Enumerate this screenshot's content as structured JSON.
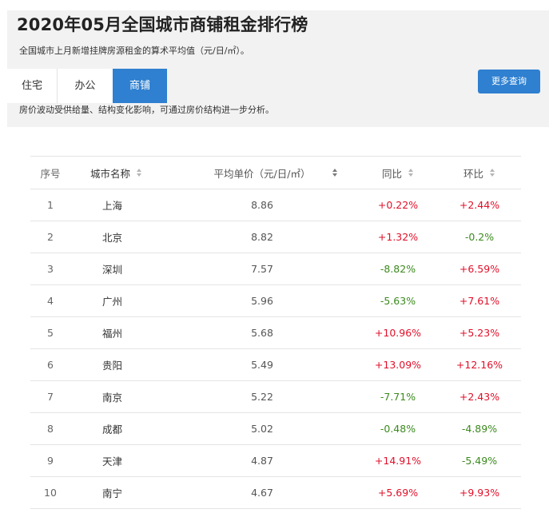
{
  "header": {
    "title": "2020年05月全国城市商铺租金排行榜",
    "subtitle": "全国城市上月新增挂牌房源租金的算术平均值（元/日/㎡）。",
    "note": "房价波动受供给量、结构变化影响，可通过房价结构进一步分析。",
    "more_button": "更多查询"
  },
  "tabs": [
    {
      "label": "住宅",
      "active": false
    },
    {
      "label": "办公",
      "active": false
    },
    {
      "label": "商铺",
      "active": true
    }
  ],
  "colors": {
    "accent": "#2f80d0",
    "positive": "#e0102a",
    "negative": "#3b8a1e"
  },
  "table": {
    "columns": {
      "rank": "序号",
      "city": "城市名称",
      "price": "平均单价（元/日/㎡）",
      "yoy": "同比",
      "mom": "环比"
    },
    "rows": [
      {
        "rank": "1",
        "city": "上海",
        "price": "8.86",
        "yoy": "+0.22%",
        "mom": "+2.44%"
      },
      {
        "rank": "2",
        "city": "北京",
        "price": "8.82",
        "yoy": "+1.32%",
        "mom": "-0.2%"
      },
      {
        "rank": "3",
        "city": "深圳",
        "price": "7.57",
        "yoy": "-8.82%",
        "mom": "+6.59%"
      },
      {
        "rank": "4",
        "city": "广州",
        "price": "5.96",
        "yoy": "-5.63%",
        "mom": "+7.61%"
      },
      {
        "rank": "5",
        "city": "福州",
        "price": "5.68",
        "yoy": "+10.96%",
        "mom": "+5.23%"
      },
      {
        "rank": "6",
        "city": "贵阳",
        "price": "5.49",
        "yoy": "+13.09%",
        "mom": "+12.16%"
      },
      {
        "rank": "7",
        "city": "南京",
        "price": "5.22",
        "yoy": "-7.71%",
        "mom": "+2.43%"
      },
      {
        "rank": "8",
        "city": "成都",
        "price": "5.02",
        "yoy": "-0.48%",
        "mom": "-4.89%"
      },
      {
        "rank": "9",
        "city": "天津",
        "price": "4.87",
        "yoy": "+14.91%",
        "mom": "-5.49%"
      },
      {
        "rank": "10",
        "city": "南宁",
        "price": "4.67",
        "yoy": "+5.69%",
        "mom": "+9.93%"
      }
    ]
  }
}
